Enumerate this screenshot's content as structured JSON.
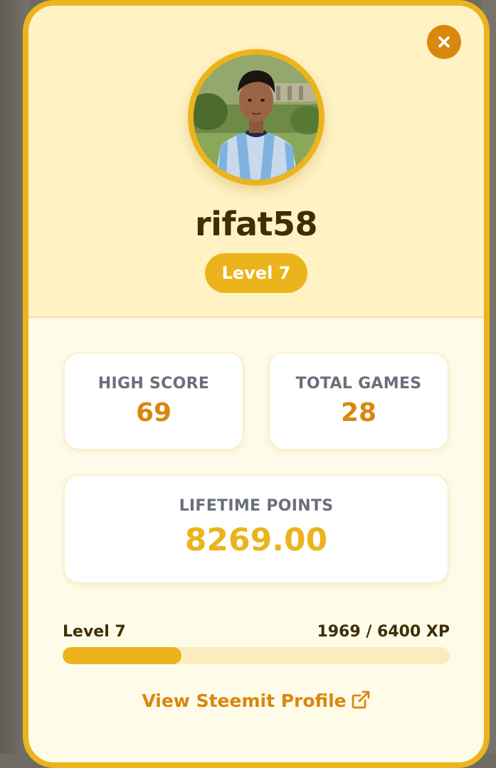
{
  "profile": {
    "username": "rifat58",
    "level_badge": "Level 7"
  },
  "close_button": {
    "icon": "close-icon"
  },
  "stats": {
    "high_score": {
      "label": "HIGH SCORE",
      "value": "69"
    },
    "total_games": {
      "label": "TOTAL GAMES",
      "value": "28"
    },
    "lifetime_points": {
      "label": "LIFETIME POINTS",
      "value": "8269.00"
    }
  },
  "xp": {
    "level_label": "Level 7",
    "progress_text": "1969 / 6400 XP",
    "current": 1969,
    "max": 6400
  },
  "link": {
    "label": "View Steemit Profile",
    "icon": "external-link-icon"
  },
  "colors": {
    "accent": "#ebb41c",
    "accent_dark": "#d9870d",
    "header_bg": "#fff3c4",
    "body_bg": "#fffbe9",
    "text_dark": "#3f2e08",
    "label_gray": "#6b6f7c"
  }
}
